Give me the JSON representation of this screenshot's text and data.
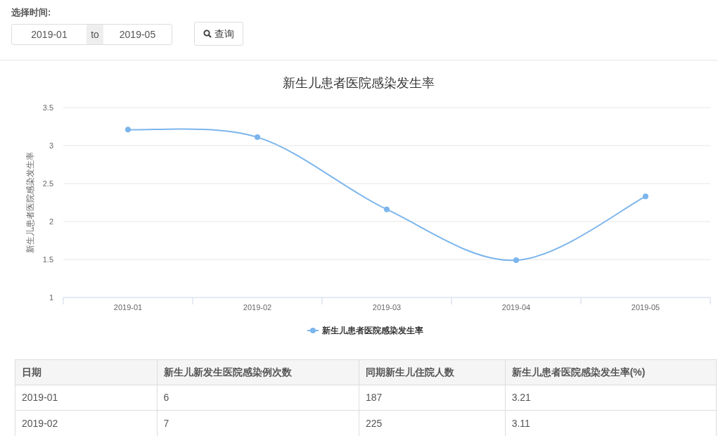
{
  "filter": {
    "label": "选择时间:",
    "start": "2019-01",
    "separator": "to",
    "end": "2019-05",
    "query_button": "查询"
  },
  "chart": {
    "chart_data": {
      "type": "line",
      "title": "新生儿患者医院感染发生率",
      "ylabel": "新生儿患者医院感染发生率",
      "categories": [
        "2019-01",
        "2019-02",
        "2019-03",
        "2019-04",
        "2019-05"
      ],
      "grid": true,
      "series": [
        {
          "name": "新生儿患者医院感染发生率",
          "color": "#7cb5ec",
          "marker": true,
          "values": [
            3.21,
            3.11,
            2.16,
            1.49,
            2.33
          ]
        }
      ],
      "ylim": [
        1,
        3.5
      ],
      "yticks": [
        {
          "value": 1,
          "label": "1"
        },
        {
          "value": 1.5,
          "label": "1.5"
        },
        {
          "value": 2,
          "label": "2"
        },
        {
          "value": 2.5,
          "label": "2.5"
        },
        {
          "value": 3,
          "label": "3"
        },
        {
          "value": 3.5,
          "label": "3.5"
        }
      ]
    }
  },
  "table": {
    "columns": [
      "日期",
      "新生儿新发生医院感染例次数",
      "同期新生儿住院人数",
      "新生儿患者医院感染发生率(%)"
    ],
    "rows": [
      [
        "2019-01",
        "6",
        "187",
        "3.21"
      ],
      [
        "2019-02",
        "7",
        "225",
        "3.11"
      ]
    ]
  }
}
